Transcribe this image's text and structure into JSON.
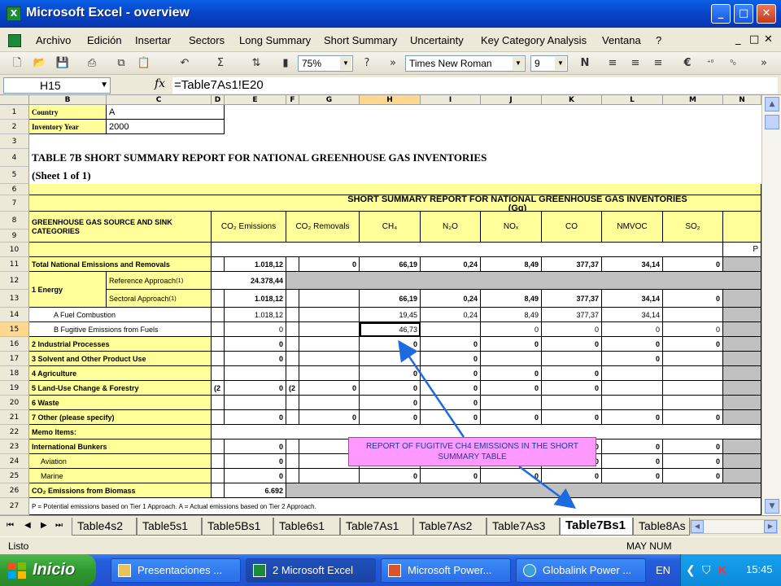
{
  "window": {
    "title": "Microsoft Excel - overview"
  },
  "window_buttons": {
    "minimize": "_",
    "maximize": "□",
    "close": "✕"
  },
  "menu": {
    "items": [
      "Archivo",
      "Edición",
      "Insertar",
      "Sectors",
      "Long Summary",
      "Short Summary",
      "Uncertainty",
      "Key Category Analysis",
      "Ventana",
      "?"
    ],
    "doc_controls": [
      "_",
      "□",
      "✕"
    ]
  },
  "toolbar": {
    "zoom": "75%",
    "font": "Times New Roman",
    "size": "9"
  },
  "formula_bar": {
    "name_box": "H15",
    "fx": "fx",
    "formula": "=Table7As1!E20"
  },
  "columns": [
    "B",
    "C",
    "D",
    "E",
    "F",
    "G",
    "H",
    "I",
    "J",
    "K",
    "L",
    "M",
    "N"
  ],
  "rows": [
    "1",
    "2",
    "3",
    "4",
    "5",
    "6",
    "7",
    "8",
    "9",
    "10",
    "11",
    "12",
    "13",
    "14",
    "15",
    "16",
    "17",
    "18",
    "19",
    "20",
    "21",
    "22",
    "23",
    "24",
    "25",
    "26",
    "27"
  ],
  "sheet": {
    "country_label": "Country",
    "country_value": "A",
    "year_label": "Inventory Year",
    "year_value": "2000",
    "table_title": "TABLE 7B SHORT SUMMARY REPORT FOR NATIONAL GREENHOUSE GAS INVENTORIES",
    "sheet_note": "(Sheet 1 of 1)",
    "banner_line1": "SHORT SUMMARY REPORT FOR NATIONAL GREENHOUSE GAS INVENTORIES",
    "banner_line2": "(Gg)",
    "categories_header": "GREENHOUSE GAS SOURCE AND SINK CATEGORIES",
    "col_headers": [
      "CO₂ Emissions",
      "CO₂ Removals",
      "CH₄",
      "N₂O",
      "NOₓ",
      "CO",
      "NMVOC",
      "SO₂"
    ],
    "p_label": "P",
    "rows": [
      {
        "label": "Total National Emissions and Removals",
        "vals": [
          "1.018,12",
          "0",
          "66,19",
          "0,24",
          "8,49",
          "377,37",
          "34,14",
          "0"
        ]
      },
      {
        "label": "1 Energy",
        "sub": "Reference Approach",
        "sup": "(1)",
        "vals": [
          "24.378,44"
        ]
      },
      {
        "sub": "Sectoral Approach",
        "sup": "(1)",
        "vals": [
          "1.018,12",
          "",
          "66,19",
          "0,24",
          "8,49",
          "377,37",
          "34,14",
          "0"
        ]
      },
      {
        "label": "A Fuel Combustion",
        "vals": [
          "1.018,12",
          "",
          "19,45",
          "0,24",
          "8,49",
          "377,37",
          "34,14",
          ""
        ]
      },
      {
        "label": "B Fugitive Emissions from Fuels",
        "vals": [
          "0",
          "",
          "46,73",
          "",
          "0",
          "0",
          "0",
          "0"
        ]
      },
      {
        "label": "2 Industrial Processes",
        "vals": [
          "0",
          "",
          "0",
          "0",
          "0",
          "0",
          "0",
          "0"
        ]
      },
      {
        "label": "3 Solvent and Other Product Use",
        "vals": [
          "0",
          "",
          "",
          "0",
          "",
          "",
          "0",
          ""
        ]
      },
      {
        "label": "4 Agriculture",
        "vals": [
          "",
          "",
          "0",
          "0",
          "0",
          "0",
          "",
          ""
        ]
      },
      {
        "label": "5 Land-Use Change & Forestry",
        "paren": "(2",
        "vals": [
          "0",
          "0",
          "0",
          "0",
          "0",
          "0",
          "",
          ""
        ]
      },
      {
        "label": "6 Waste",
        "vals": [
          "",
          "",
          "0",
          "0",
          "",
          "",
          "",
          ""
        ]
      },
      {
        "label": "7 Other (please specify)",
        "vals": [
          "0",
          "0",
          "0",
          "0",
          "0",
          "0",
          "0",
          "0"
        ]
      },
      {
        "label": "Memo Items:"
      },
      {
        "label": "International Bunkers",
        "vals": [
          "0",
          "",
          "",
          "",
          "",
          "0",
          "0",
          "0"
        ]
      },
      {
        "label": "Aviation",
        "vals": [
          "0",
          "",
          "",
          "",
          "",
          "0",
          "0",
          "0"
        ]
      },
      {
        "label": "Marine",
        "vals": [
          "0",
          "",
          "0",
          "0",
          "0",
          "0",
          "0",
          "0"
        ]
      },
      {
        "label": "CO₂ Emissions from Biomass",
        "vals": [
          "6.692"
        ]
      }
    ],
    "footnote": "P = Potential emissions based on Tier 1 Approach.  A = Actual emissions based on Tier 2 Approach."
  },
  "annotation": "REPORT OF FUGITIVE CH4 EMISSIONS IN THE SHORT SUMMARY TABLE",
  "tab_nav": [
    "⏮",
    "◀",
    "▶",
    "⏭"
  ],
  "tabs": [
    "Table4s2",
    "Table5s1",
    "Table5Bs1",
    "Table6s1",
    "Table7As1",
    "Table7As2",
    "Table7As3",
    "Table7Bs1",
    "Table8As"
  ],
  "active_tab": "Table7Bs1",
  "status": {
    "left": "Listo",
    "right": "MAY NUM"
  },
  "taskbar": {
    "start": "Inicio",
    "items": [
      "Presentaciones ...",
      "2 Microsoft Excel",
      "Microsoft Power...",
      "Globalink Power ..."
    ],
    "lang": "EN",
    "clock": "15:45"
  },
  "colors": {
    "yellow": "#ffff99",
    "grey": "#c0c0c0",
    "annotation_bg": "#ff99ff",
    "arrow": "#1e6ae0"
  }
}
